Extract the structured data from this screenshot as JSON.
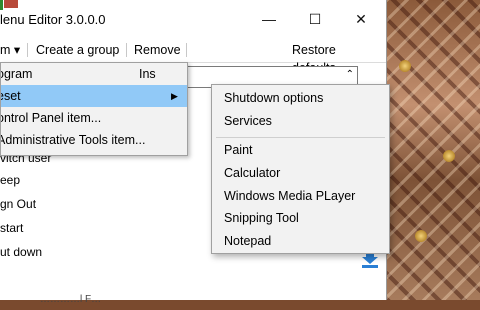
{
  "window": {
    "title": "lenu Editor 3.0.0.0",
    "minimize_glyph": "—",
    "maximize_glyph": "☐",
    "close_glyph": "✕"
  },
  "menubar": {
    "items": [
      {
        "label": "m ▾"
      },
      {
        "label": "Create a group"
      },
      {
        "label": "Remove"
      },
      {
        "label": "Restore defaults"
      }
    ]
  },
  "combo": {
    "arrow": "⌃"
  },
  "list": {
    "items": [
      {
        "label": "vitch user"
      },
      {
        "label": "eep"
      },
      {
        "label": "gn Out"
      },
      {
        "label": "start"
      },
      {
        "label": "ut down"
      },
      {
        "label": "…………l F…"
      }
    ]
  },
  "dropdown": {
    "items": [
      {
        "label": "ogram",
        "shortcut": "Ins"
      },
      {
        "label": "eset",
        "arrow": "▶"
      },
      {
        "label": "ontrol Panel item..."
      },
      {
        "label": "Administrative Tools item..."
      }
    ]
  },
  "submenu": {
    "group1": [
      "Shutdown options",
      "Services"
    ],
    "group2": [
      "Paint",
      "Calculator",
      "Windows Media PLayer",
      "Snipping Tool",
      "Notepad"
    ]
  },
  "colors": {
    "highlight": "#91c9f7",
    "menu_bg": "#f2f2f2",
    "download_icon": "#2a7fd4"
  }
}
